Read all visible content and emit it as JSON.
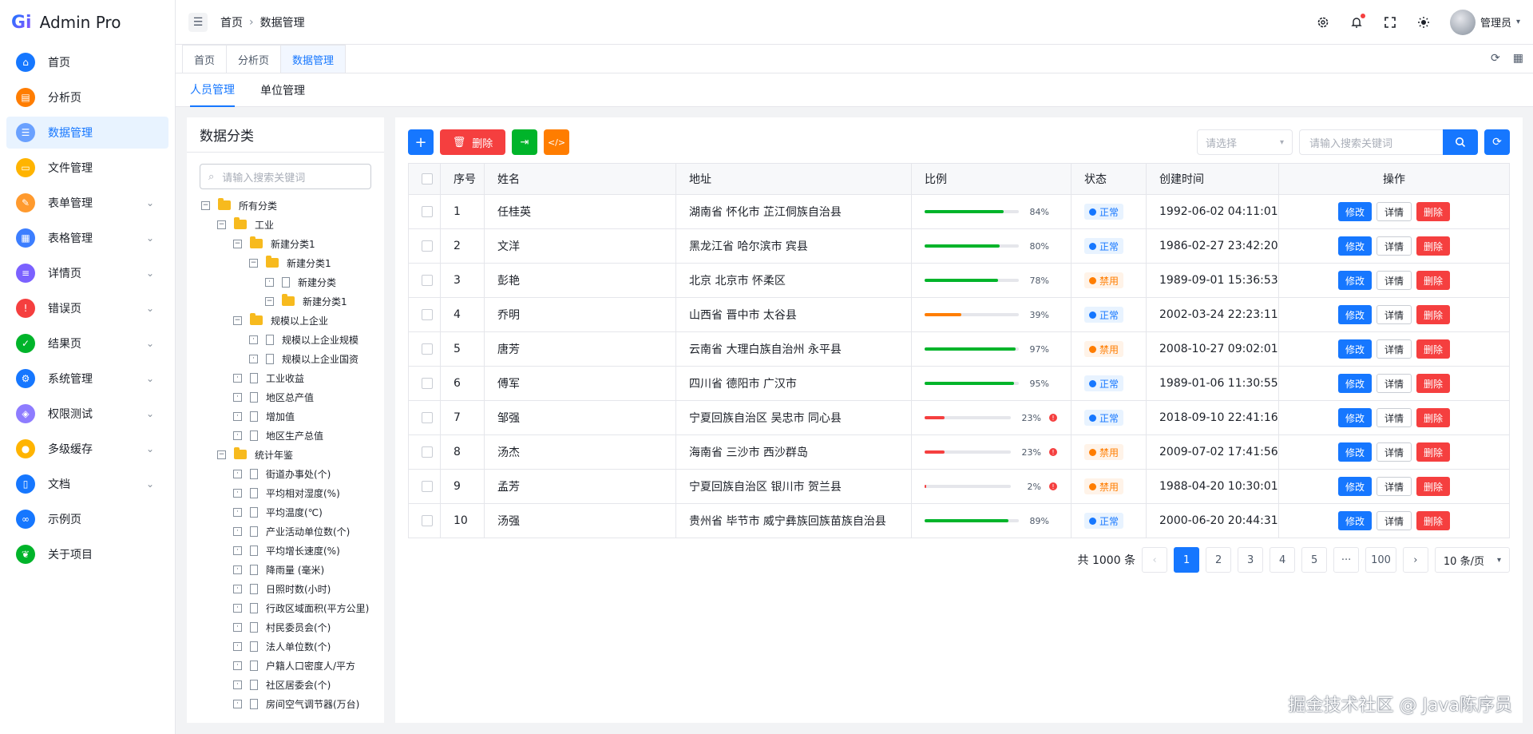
{
  "app": {
    "logo": "Gi",
    "title": "Admin Pro"
  },
  "menu": [
    {
      "label": "首页",
      "color": "#1677ff",
      "icon": "home-icon",
      "arrow": false,
      "active": false
    },
    {
      "label": "分析页",
      "color": "#ff7d00",
      "icon": "chart-icon",
      "arrow": false,
      "active": false
    },
    {
      "label": "数据管理",
      "color": "#6aa1ff",
      "icon": "table-icon",
      "arrow": false,
      "active": true
    },
    {
      "label": "文件管理",
      "color": "#ffb400",
      "icon": "folder-icon",
      "arrow": false,
      "active": false
    },
    {
      "label": "表单管理",
      "color": "#ff9a2e",
      "icon": "form-icon",
      "arrow": true,
      "active": false
    },
    {
      "label": "表格管理",
      "color": "#3c7eff",
      "icon": "grid-icon",
      "arrow": true,
      "active": false
    },
    {
      "label": "详情页",
      "color": "#7b61ff",
      "icon": "detail-icon",
      "arrow": true,
      "active": false
    },
    {
      "label": "错误页",
      "color": "#f53f3f",
      "icon": "error-icon",
      "arrow": true,
      "active": false
    },
    {
      "label": "结果页",
      "color": "#00b42a",
      "icon": "result-icon",
      "arrow": true,
      "active": false
    },
    {
      "label": "系统管理",
      "color": "#1677ff",
      "icon": "gear-icon",
      "arrow": true,
      "active": false
    },
    {
      "label": "权限测试",
      "color": "#8e7cff",
      "icon": "shield-icon",
      "arrow": true,
      "active": false
    },
    {
      "label": "多级缓存",
      "color": "#ffb400",
      "icon": "cache-icon",
      "arrow": true,
      "active": false
    },
    {
      "label": "文档",
      "color": "#1677ff",
      "icon": "doc-icon",
      "arrow": true,
      "active": false
    },
    {
      "label": "示例页",
      "color": "#1677ff",
      "icon": "example-icon",
      "arrow": false,
      "active": false
    },
    {
      "label": "关于项目",
      "color": "#00b42a",
      "icon": "leaf-icon",
      "arrow": false,
      "active": false
    }
  ],
  "header": {
    "breadcrumb": [
      "首页",
      "数据管理"
    ],
    "user": "管理员"
  },
  "tabs": [
    "首页",
    "分析页",
    "数据管理"
  ],
  "active_tab": 2,
  "subtabs": [
    "人员管理",
    "单位管理"
  ],
  "tree": {
    "title": "数据分类",
    "search_placeholder": "请输入搜索关键词",
    "nodes": [
      {
        "level": 0,
        "type": "folder",
        "label": "所有分类"
      },
      {
        "level": 1,
        "type": "folder",
        "label": "工业"
      },
      {
        "level": 2,
        "type": "folder",
        "label": "新建分类1"
      },
      {
        "level": 3,
        "type": "folder",
        "label": "新建分类1"
      },
      {
        "level": 4,
        "type": "file",
        "label": "新建分类"
      },
      {
        "level": 4,
        "type": "folder",
        "label": "新建分类1"
      },
      {
        "level": 2,
        "type": "folder",
        "label": "规模以上企业"
      },
      {
        "level": 3,
        "type": "file",
        "label": "规模以上企业规模"
      },
      {
        "level": 3,
        "type": "file",
        "label": "规模以上企业国资"
      },
      {
        "level": 2,
        "type": "file",
        "label": "工业收益"
      },
      {
        "level": 2,
        "type": "file",
        "label": "地区总产值"
      },
      {
        "level": 2,
        "type": "file",
        "label": "增加值"
      },
      {
        "level": 2,
        "type": "file",
        "label": "地区生产总值"
      },
      {
        "level": 1,
        "type": "folder",
        "label": "统计年鉴"
      },
      {
        "level": 2,
        "type": "file",
        "label": "街道办事处(个)"
      },
      {
        "level": 2,
        "type": "file",
        "label": "平均相对湿度(%)"
      },
      {
        "level": 2,
        "type": "file",
        "label": "平均温度(℃)"
      },
      {
        "level": 2,
        "type": "file",
        "label": "产业活动单位数(个)"
      },
      {
        "level": 2,
        "type": "file",
        "label": "平均增长速度(%)"
      },
      {
        "level": 2,
        "type": "file",
        "label": "降雨量 (毫米)"
      },
      {
        "level": 2,
        "type": "file",
        "label": "日照时数(小时)"
      },
      {
        "level": 2,
        "type": "file",
        "label": "行政区域面积(平方公里)"
      },
      {
        "level": 2,
        "type": "file",
        "label": "村民委员会(个)"
      },
      {
        "level": 2,
        "type": "file",
        "label": "法人单位数(个)"
      },
      {
        "level": 2,
        "type": "file",
        "label": "户籍人口密度人/平方"
      },
      {
        "level": 2,
        "type": "file",
        "label": "社区居委会(个)"
      },
      {
        "level": 2,
        "type": "file",
        "label": "房间空气调节器(万台)"
      }
    ]
  },
  "toolbar": {
    "delete_label": "删除",
    "select_placeholder": "请选择",
    "search_placeholder": "请输入搜索关键词"
  },
  "table": {
    "columns": [
      "序号",
      "姓名",
      "地址",
      "比例",
      "状态",
      "创建时间",
      "操作"
    ],
    "rows": [
      {
        "no": "1",
        "name": "任桂英",
        "addr": "湖南省 怀化市 芷江侗族自治县",
        "pct": 84,
        "pct_label": "84%",
        "status": "正常",
        "ok": true,
        "time": "1992-06-02 04:11:01"
      },
      {
        "no": "2",
        "name": "文洋",
        "addr": "黑龙江省 哈尔滨市 宾县",
        "pct": 80,
        "pct_label": "80%",
        "status": "正常",
        "ok": true,
        "time": "1986-02-27 23:42:20"
      },
      {
        "no": "3",
        "name": "彭艳",
        "addr": "北京 北京市 怀柔区",
        "pct": 78,
        "pct_label": "78%",
        "status": "禁用",
        "ok": false,
        "time": "1989-09-01 15:36:53"
      },
      {
        "no": "4",
        "name": "乔明",
        "addr": "山西省 晋中市 太谷县",
        "pct": 39,
        "pct_label": "39%",
        "status": "正常",
        "ok": true,
        "time": "2002-03-24 22:23:11"
      },
      {
        "no": "5",
        "name": "唐芳",
        "addr": "云南省 大理白族自治州 永平县",
        "pct": 97,
        "pct_label": "97%",
        "status": "禁用",
        "ok": false,
        "time": "2008-10-27 09:02:01"
      },
      {
        "no": "6",
        "name": "傅军",
        "addr": "四川省 德阳市 广汉市",
        "pct": 95,
        "pct_label": "95%",
        "status": "正常",
        "ok": true,
        "time": "1989-01-06 11:30:55"
      },
      {
        "no": "7",
        "name": "邹强",
        "addr": "宁夏回族自治区 吴忠市 同心县",
        "pct": 23,
        "pct_label": "23%",
        "status": "正常",
        "ok": true,
        "time": "2018-09-10 22:41:16"
      },
      {
        "no": "8",
        "name": "汤杰",
        "addr": "海南省 三沙市 西沙群岛",
        "pct": 23,
        "pct_label": "23%",
        "status": "禁用",
        "ok": false,
        "time": "2009-07-02 17:41:56"
      },
      {
        "no": "9",
        "name": "孟芳",
        "addr": "宁夏回族自治区 银川市 贺兰县",
        "pct": 2,
        "pct_label": "2%",
        "status": "禁用",
        "ok": false,
        "time": "1988-04-20 10:30:01"
      },
      {
        "no": "10",
        "name": "汤强",
        "addr": "贵州省 毕节市 威宁彝族回族苗族自治县",
        "pct": 89,
        "pct_label": "89%",
        "status": "正常",
        "ok": true,
        "time": "2000-06-20 20:44:31"
      }
    ],
    "ops": {
      "edit": "修改",
      "detail": "详情",
      "delete": "删除"
    }
  },
  "pagination": {
    "total": "共 1000 条",
    "pages": [
      "1",
      "2",
      "3",
      "4",
      "5",
      "···",
      "100"
    ],
    "current": "1",
    "page_size": "10 条/页"
  },
  "watermark": "掘金技术社区 @ Java陈序员"
}
